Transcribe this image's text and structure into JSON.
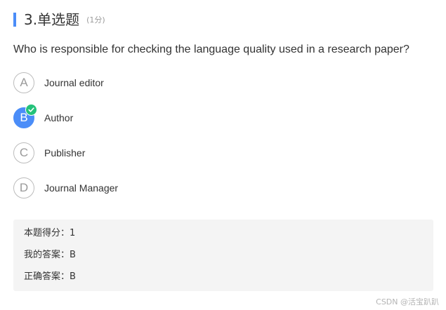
{
  "question": {
    "title": "3.单选题",
    "score": "(1分)",
    "text": "Who is responsible for checking the language quality used in a research paper?"
  },
  "options": [
    {
      "letter": "A",
      "label": "Journal editor",
      "selected": false
    },
    {
      "letter": "B",
      "label": "Author",
      "selected": true
    },
    {
      "letter": "C",
      "label": "Publisher",
      "selected": false
    },
    {
      "letter": "D",
      "label": "Journal Manager",
      "selected": false
    }
  ],
  "result": {
    "score_line": "本题得分：1",
    "my_answer_line": "我的答案：B",
    "correct_answer_line": "正确答案：B"
  },
  "watermark": "CSDN @活宝趴趴",
  "colors": {
    "accent": "#4b8df8",
    "check": "#24c27a",
    "result_bg": "#f4f4f4"
  },
  "icons": {
    "selected_badge": "check-icon"
  }
}
